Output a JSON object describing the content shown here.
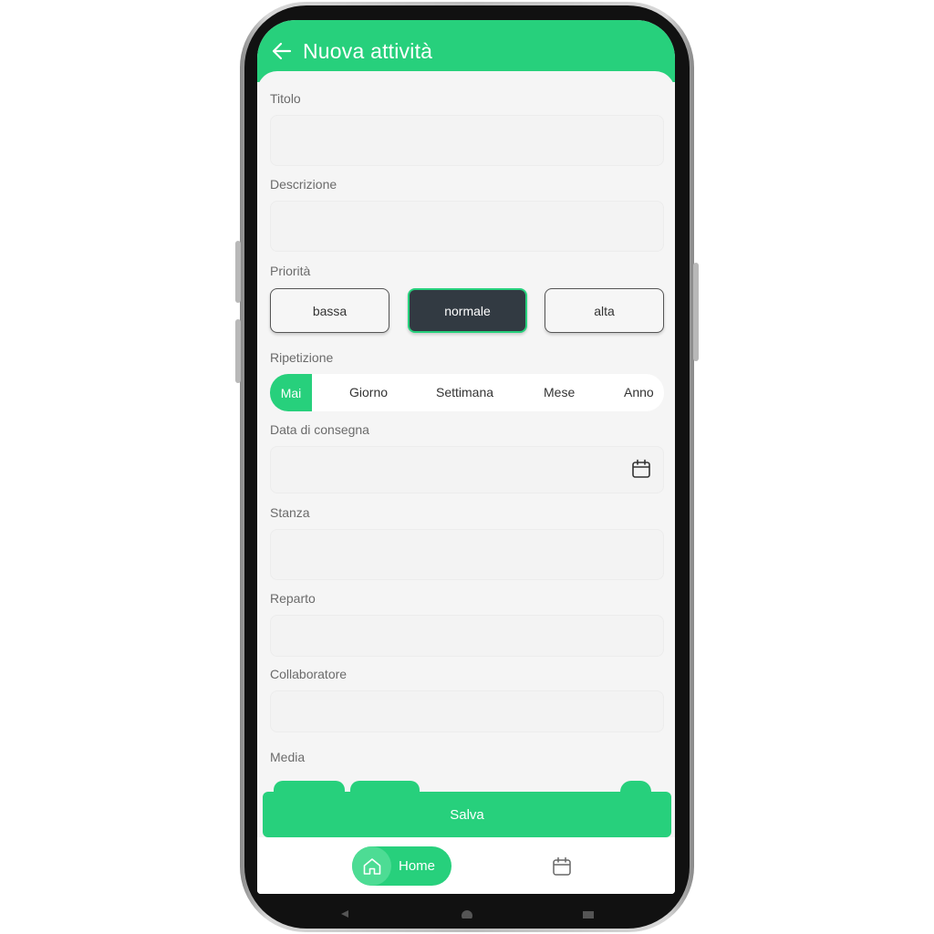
{
  "header": {
    "title": "Nuova attività",
    "back_icon": "arrow-left-icon"
  },
  "form": {
    "title_label": "Titolo",
    "title_value": "",
    "description_label": "Descrizione",
    "description_value": "",
    "priority_label": "Priorità",
    "priority_options": [
      "bassa",
      "normale",
      "alta"
    ],
    "priority_selected": "normale",
    "repeat_label": "Ripetizione",
    "repeat_options": [
      "Mai",
      "Giorno",
      "Settimana",
      "Mese",
      "Anno"
    ],
    "repeat_selected": "Mai",
    "due_date_label": "Data di consegna",
    "due_date_value": "",
    "room_label": "Stanza",
    "room_value": "",
    "department_label": "Reparto",
    "department_value": "",
    "collaborator_label": "Collaboratore",
    "collaborator_value": "",
    "media_label": "Media"
  },
  "actions": {
    "save_label": "Salva"
  },
  "bottom_nav": {
    "home_label": "Home",
    "home_icon": "home-icon",
    "calendar_icon": "calendar-icon"
  },
  "colors": {
    "accent": "#27d07c",
    "selected_button": "#323a42",
    "background": "#f5f5f5"
  }
}
